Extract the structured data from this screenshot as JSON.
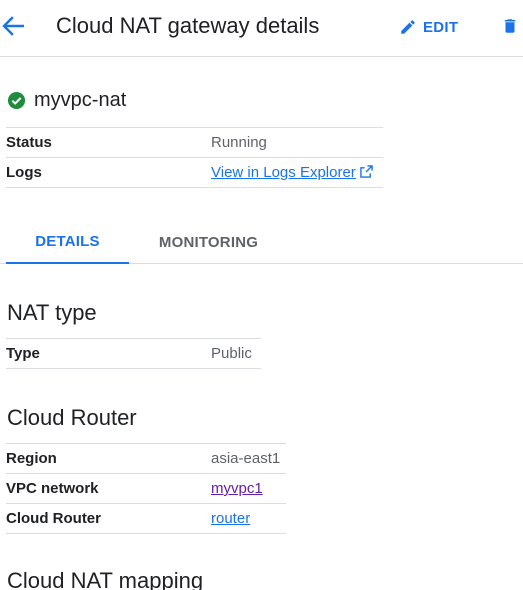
{
  "header": {
    "title": "Cloud NAT gateway details",
    "edit_label": "EDIT"
  },
  "resource": {
    "name": "myvpc-nat",
    "status_color": "#1e8e3e"
  },
  "summary": {
    "status_label": "Status",
    "status_value": "Running",
    "logs_label": "Logs",
    "logs_link": "View in Logs Explorer"
  },
  "tabs": [
    {
      "label": "DETAILS",
      "active": true
    },
    {
      "label": "MONITORING",
      "active": false
    }
  ],
  "nat_type": {
    "title": "NAT type",
    "type_label": "Type",
    "type_value": "Public"
  },
  "cloud_router": {
    "title": "Cloud Router",
    "region_label": "Region",
    "region_value": "asia-east1",
    "network_label": "VPC network",
    "network_value": "myvpc1",
    "router_label": "Cloud Router",
    "router_value": "router"
  },
  "nat_mapping": {
    "title": "Cloud NAT mapping"
  },
  "colors": {
    "accent": "#1a73e8",
    "visited_link": "#681da8",
    "divider": "#dadce0"
  }
}
